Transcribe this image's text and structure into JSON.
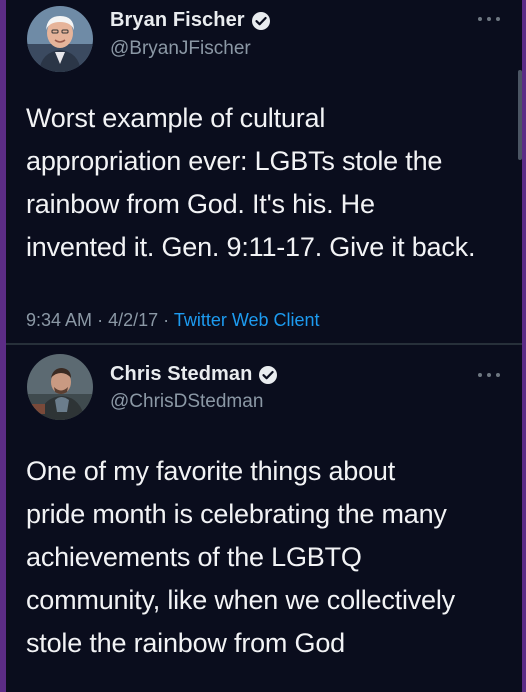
{
  "tweets": [
    {
      "display_name": "Bryan Fischer",
      "handle": "@BryanJFischer",
      "verified": true,
      "text_lines": [
        "Worst example of cultural",
        "appropriation ever: LGBTs stole the",
        "rainbow from God. It's his. He",
        "invented it. Gen. 9:11-17. Give it back."
      ],
      "time": "9:34 AM",
      "separator": "·",
      "date": "4/2/17",
      "source": "Twitter Web Client"
    },
    {
      "display_name": "Chris Stedman",
      "handle": "@ChrisDStedman",
      "verified": true,
      "text_lines": [
        "One of my favorite things about",
        "pride month is celebrating the many",
        "achievements of the LGBTQ",
        "community, like when we collectively",
        "stole the rainbow from God"
      ]
    }
  ],
  "icons": {
    "verified": "verified-badge-icon",
    "more": "more-options-icon"
  },
  "colors": {
    "background": "#0a0d1d",
    "outer_border": "#5c2c86",
    "text": "#f2f3f5",
    "secondary_text": "#8b98a5",
    "link": "#1d9bf0"
  }
}
